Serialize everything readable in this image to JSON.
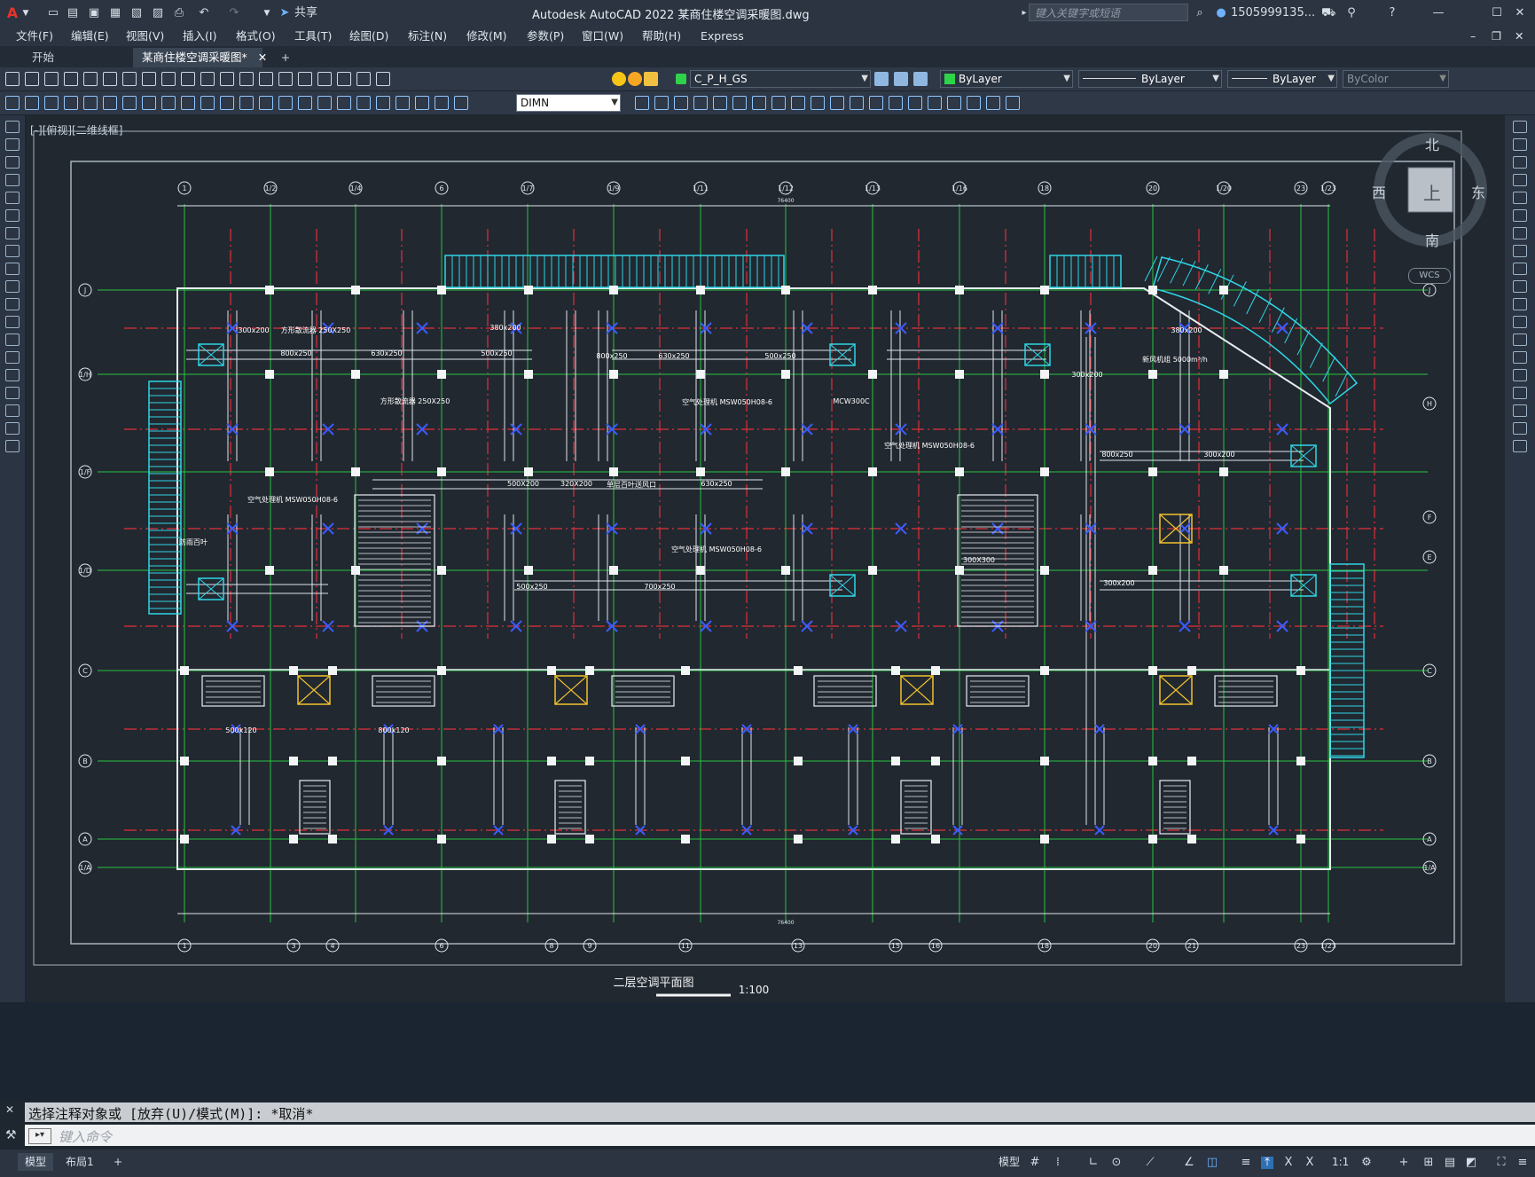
{
  "app": {
    "logo": "A",
    "title": "Autodesk AutoCAD 2022    某商住楼空调采暖图.dwg",
    "share_label": "共享",
    "search_placeholder": "键入关键字或短语",
    "user": "1505999135...",
    "help": "?"
  },
  "menu": [
    "文件(F)",
    "编辑(E)",
    "视图(V)",
    "插入(I)",
    "格式(O)",
    "工具(T)",
    "绘图(D)",
    "标注(N)",
    "修改(M)",
    "参数(P)",
    "窗口(W)",
    "帮助(H)",
    "Express"
  ],
  "tabs": [
    {
      "label": "开始"
    },
    {
      "label": "某商住楼空调采暖图*"
    }
  ],
  "toolbar": {
    "layer_combo": "C_P_H_GS",
    "color_combo": "ByLayer",
    "linetype_combo": "ByLayer",
    "lineweight_combo": "ByLayer",
    "plotstyle_combo": "ByColor",
    "dimstyle_combo": "DIMN"
  },
  "viewport_label": "[-][俯视][二维线框]",
  "viewcube": {
    "north": "北",
    "south": "南",
    "east": "东",
    "west": "西",
    "top": "上",
    "wcs": "WCS"
  },
  "drawing": {
    "title": "二层空调平面图",
    "scale": "1:100",
    "top_axes": [
      "1",
      "1/2",
      "1/4",
      "6",
      "1/7",
      "1/9",
      "1/11",
      "1/12",
      "1/13",
      "1/16",
      "18",
      "20",
      "1/20",
      "23",
      "1/23"
    ],
    "bottom_axes": [
      "1",
      "3",
      "4",
      "6",
      "8",
      "9",
      "11",
      "13",
      "15",
      "16",
      "18",
      "20",
      "21",
      "23",
      "1/23"
    ],
    "left_axes": [
      "J",
      "1/H",
      "1/F",
      "1/D",
      "C",
      "B",
      "A",
      "1/A"
    ],
    "right_axes": [
      "J",
      "H",
      "F",
      "E",
      "C",
      "B",
      "A",
      "1/A"
    ],
    "total_dim": "76400",
    "annotations": [
      "800x250",
      "630x250",
      "500x250",
      "300x200",
      "380x200",
      "800x250",
      "630x250",
      "500x250",
      "700x250",
      "500x250",
      "500X200",
      "320X200",
      "630x250",
      "800x250",
      "300x200",
      "300x200",
      "380x200",
      "300x200",
      "方形散流器 250X250",
      "方形散流器 250X250",
      "空气处理机 MSW050H08-6",
      "空气处理机 MSW050H08-6",
      "空气处理机 MSW050H08-6",
      "空气处理机 MSW050H08-6",
      "新风机组 5000m³/h",
      "MCW300C",
      "300X300",
      "500x120",
      "800x120",
      "单层百叶送风口",
      "防雨百叶"
    ]
  },
  "command": {
    "history": "选择注释对象或 [放弃(U)/模式(M)]: *取消*",
    "placeholder": "键入命令"
  },
  "status": {
    "model_tab": "模型",
    "layout_tab": "布局1",
    "add_tab": "+",
    "model_label": "模型",
    "scale": "1:1"
  }
}
